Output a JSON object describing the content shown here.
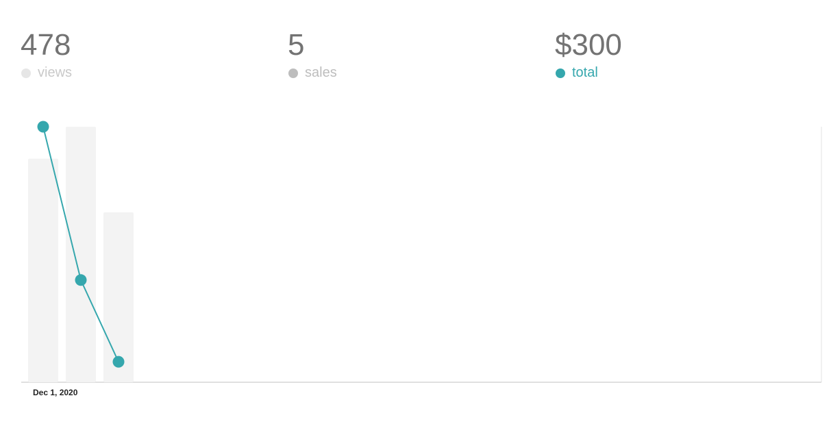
{
  "stats": [
    {
      "value": "478",
      "label": "views",
      "dot_color": "#e6e6e6",
      "label_color": "#c9c9c9"
    },
    {
      "value": "5",
      "label": "sales",
      "dot_color": "#bdbdbd",
      "label_color": "#bdbdbd"
    },
    {
      "value": "$300",
      "label": "total",
      "dot_color": "#35a7ad",
      "label_color": "#35a7ad"
    }
  ],
  "chart_data": {
    "type": "bar",
    "x_tick_labels": [
      "Dec 1, 2020"
    ],
    "bar_series": {
      "name": "views",
      "values": [
        175,
        200,
        133
      ],
      "color": "#f3f3f3"
    },
    "line_series": {
      "name": "total",
      "values": [
        150,
        60,
        12
      ],
      "color": "#35a7ad"
    },
    "y_max_bars": 200,
    "y_max_line": 150,
    "grid": false,
    "legend": "top"
  }
}
